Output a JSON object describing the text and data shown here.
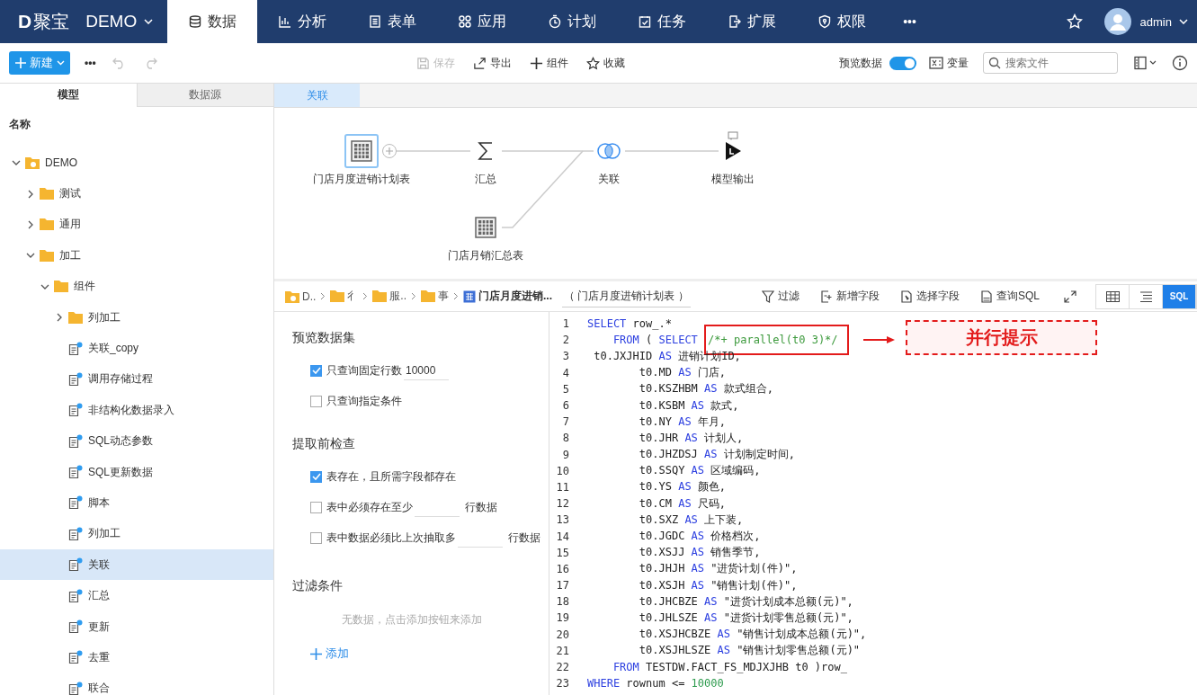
{
  "nav": {
    "logo_letter": "D",
    "logo_text": "聚宝",
    "project": "DEMO",
    "tabs": [
      {
        "label": "数据",
        "selected": true
      },
      {
        "label": "分析",
        "selected": false
      },
      {
        "label": "表单",
        "selected": false
      },
      {
        "label": "应用",
        "selected": false
      },
      {
        "label": "计划",
        "selected": false
      },
      {
        "label": "任务",
        "selected": false
      },
      {
        "label": "扩展",
        "selected": false
      },
      {
        "label": "权限",
        "selected": false
      }
    ],
    "more": "•••",
    "user": "admin"
  },
  "toolbar": {
    "new_button": "新建",
    "more": "•••",
    "actions": [
      {
        "label": "保存",
        "disabled": true
      },
      {
        "label": "导出",
        "disabled": false
      },
      {
        "label": "组件",
        "disabled": false
      },
      {
        "label": "收藏",
        "disabled": false
      }
    ],
    "preview_toggle": {
      "label": "预览数据",
      "on": true
    },
    "variables": "变量",
    "search": {
      "placeholder": "搜索文件"
    }
  },
  "sidebar": {
    "tabs": [
      {
        "label": "模型",
        "selected": true
      },
      {
        "label": "数据源",
        "selected": false
      }
    ],
    "header": "名称",
    "tree": [
      {
        "label": "DEMO",
        "kind": "root",
        "expanded": true,
        "selected": false,
        "children": [
          {
            "label": "测试",
            "kind": "folder",
            "expanded": false,
            "selected": false
          },
          {
            "label": "通用",
            "kind": "folder",
            "expanded": false,
            "selected": false
          },
          {
            "label": "加工",
            "kind": "folder",
            "expanded": true,
            "selected": false,
            "children": [
              {
                "label": "组件",
                "kind": "folder",
                "expanded": true,
                "selected": false,
                "children": [
                  {
                    "label": "列加工",
                    "kind": "folder",
                    "expanded": false,
                    "selected": false
                  },
                  {
                    "label": "关联_copy",
                    "kind": "model",
                    "selected": false
                  },
                  {
                    "label": "调用存储过程",
                    "kind": "model",
                    "selected": false
                  },
                  {
                    "label": "非结构化数据录入",
                    "kind": "model",
                    "selected": false
                  },
                  {
                    "label": "SQL动态参数",
                    "kind": "model",
                    "selected": false
                  },
                  {
                    "label": "SQL更新数据",
                    "kind": "model",
                    "selected": false
                  },
                  {
                    "label": "脚本",
                    "kind": "model",
                    "selected": false
                  },
                  {
                    "label": "列加工",
                    "kind": "model",
                    "selected": false
                  },
                  {
                    "label": "关联",
                    "kind": "model",
                    "selected": true
                  },
                  {
                    "label": "汇总",
                    "kind": "model",
                    "selected": false
                  },
                  {
                    "label": "更新",
                    "kind": "model",
                    "selected": false
                  },
                  {
                    "label": "去重",
                    "kind": "model",
                    "selected": false
                  },
                  {
                    "label": "联合",
                    "kind": "model",
                    "selected": false
                  }
                ]
              }
            ]
          }
        ]
      }
    ]
  },
  "editor_tabs": [
    {
      "label": "关联",
      "selected": true
    }
  ],
  "flow": {
    "nodes": [
      {
        "label": "门店月度进销计划表",
        "kind": "table",
        "selected": true
      },
      {
        "label": "汇总",
        "kind": "sum",
        "selected": false
      },
      {
        "label": "关联",
        "kind": "join",
        "selected": false
      },
      {
        "label": "模型输出",
        "kind": "output",
        "selected": false
      },
      {
        "label": "门店月销汇总表",
        "kind": "table",
        "selected": false
      }
    ]
  },
  "detail": {
    "breadcrumb": [
      {
        "label": "D..",
        "kind": "root"
      },
      {
        "label": "彳",
        "kind": "folder"
      },
      {
        "label": "服..",
        "kind": "folder"
      },
      {
        "label": "事",
        "kind": "folder"
      },
      {
        "label": "门店月度进销...",
        "kind": "table"
      }
    ],
    "alias": "（ 门店月度进销计划表 ）",
    "actions": [
      "过滤",
      "新增字段",
      "选择字段",
      "查询SQL"
    ],
    "views": [
      {
        "kind": "grid",
        "selected": false
      },
      {
        "kind": "list",
        "selected": false
      },
      {
        "kind": "sql",
        "label": "SQL",
        "selected": true
      }
    ]
  },
  "settings": {
    "sections": [
      {
        "title": "预览数据集",
        "options": [
          {
            "label": "只查询固定行数",
            "checked": true,
            "kind": "input",
            "value": "10000"
          },
          {
            "label": "只查询指定条件",
            "checked": false,
            "kind": "plain"
          }
        ]
      },
      {
        "title": "提取前检查",
        "options": [
          {
            "label": "表存在，且所需字段都存在",
            "checked": true,
            "kind": "plain"
          },
          {
            "label": "表中必须存在至少",
            "checked": false,
            "kind": "input",
            "suffix": "行数据"
          },
          {
            "label": "表中数据必须比上次抽取多",
            "checked": false,
            "kind": "input",
            "suffix": "行数据"
          }
        ]
      }
    ],
    "filter": {
      "title": "过滤条件",
      "empty": "无数据，点击添加按钮来添加",
      "add": "添加"
    }
  },
  "sql": {
    "annotation": "并行提示",
    "lines": [
      {
        "number": "1",
        "segments": [
          {
            "text": "SELECT",
            "kind": "kw"
          },
          {
            "text": " row_.*",
            "kind": "plain"
          }
        ]
      },
      {
        "number": "2",
        "segments": [
          {
            "text": "    FROM",
            "kind": "kw"
          },
          {
            "text": " ( ",
            "kind": "plain"
          },
          {
            "text": "SELECT ",
            "kind": "kw"
          },
          {
            "text": "/*+ parallel(t0 3)*/",
            "kind": "comment",
            "marked": true
          }
        ]
      },
      {
        "number": "3",
        "segments": [
          {
            "text": " t0.JXJHID ",
            "kind": "plain"
          },
          {
            "text": "AS",
            "kind": "kw"
          },
          {
            "text": " 进销计划ID,",
            "kind": "plain"
          }
        ]
      },
      {
        "number": "4",
        "segments": [
          {
            "text": "        t0.MD ",
            "kind": "plain"
          },
          {
            "text": "AS",
            "kind": "kw"
          },
          {
            "text": " 门店,",
            "kind": "plain"
          }
        ]
      },
      {
        "number": "5",
        "segments": [
          {
            "text": "        t0.KSZHBM ",
            "kind": "plain"
          },
          {
            "text": "AS",
            "kind": "kw"
          },
          {
            "text": " 款式组合,",
            "kind": "plain"
          }
        ]
      },
      {
        "number": "6",
        "segments": [
          {
            "text": "        t0.KSBM ",
            "kind": "plain"
          },
          {
            "text": "AS",
            "kind": "kw"
          },
          {
            "text": " 款式,",
            "kind": "plain"
          }
        ]
      },
      {
        "number": "7",
        "segments": [
          {
            "text": "        t0.NY ",
            "kind": "plain"
          },
          {
            "text": "AS",
            "kind": "kw"
          },
          {
            "text": " 年月,",
            "kind": "plain"
          }
        ]
      },
      {
        "number": "8",
        "segments": [
          {
            "text": "        t0.JHR ",
            "kind": "plain"
          },
          {
            "text": "AS",
            "kind": "kw"
          },
          {
            "text": " 计划人,",
            "kind": "plain"
          }
        ]
      },
      {
        "number": "9",
        "segments": [
          {
            "text": "        t0.JHZDSJ ",
            "kind": "plain"
          },
          {
            "text": "AS",
            "kind": "kw"
          },
          {
            "text": " 计划制定时间,",
            "kind": "plain"
          }
        ]
      },
      {
        "number": "10",
        "segments": [
          {
            "text": "        t0.SSQY ",
            "kind": "plain"
          },
          {
            "text": "AS",
            "kind": "kw"
          },
          {
            "text": " 区域编码,",
            "kind": "plain"
          }
        ]
      },
      {
        "number": "11",
        "segments": [
          {
            "text": "        t0.YS ",
            "kind": "plain"
          },
          {
            "text": "AS",
            "kind": "kw"
          },
          {
            "text": " 颜色,",
            "kind": "plain"
          }
        ]
      },
      {
        "number": "12",
        "segments": [
          {
            "text": "        t0.CM ",
            "kind": "plain"
          },
          {
            "text": "AS",
            "kind": "kw"
          },
          {
            "text": " 尺码,",
            "kind": "plain"
          }
        ]
      },
      {
        "number": "13",
        "segments": [
          {
            "text": "        t0.SXZ ",
            "kind": "plain"
          },
          {
            "text": "AS",
            "kind": "kw"
          },
          {
            "text": " 上下装,",
            "kind": "plain"
          }
        ]
      },
      {
        "number": "14",
        "segments": [
          {
            "text": "        t0.JGDC ",
            "kind": "plain"
          },
          {
            "text": "AS",
            "kind": "kw"
          },
          {
            "text": " 价格档次,",
            "kind": "plain"
          }
        ]
      },
      {
        "number": "15",
        "segments": [
          {
            "text": "        t0.XSJJ ",
            "kind": "plain"
          },
          {
            "text": "AS",
            "kind": "kw"
          },
          {
            "text": " 销售季节,",
            "kind": "plain"
          }
        ]
      },
      {
        "number": "16",
        "segments": [
          {
            "text": "        t0.JHJH ",
            "kind": "plain"
          },
          {
            "text": "AS",
            "kind": "kw"
          },
          {
            "text": " \"进货计划(件)\",",
            "kind": "plain"
          }
        ]
      },
      {
        "number": "17",
        "segments": [
          {
            "text": "        t0.XSJH ",
            "kind": "plain"
          },
          {
            "text": "AS",
            "kind": "kw"
          },
          {
            "text": " \"销售计划(件)\",",
            "kind": "plain"
          }
        ]
      },
      {
        "number": "18",
        "segments": [
          {
            "text": "        t0.JHCBZE ",
            "kind": "plain"
          },
          {
            "text": "AS",
            "kind": "kw"
          },
          {
            "text": " \"进货计划成本总额(元)\",",
            "kind": "plain"
          }
        ]
      },
      {
        "number": "19",
        "segments": [
          {
            "text": "        t0.JHLSZE ",
            "kind": "plain"
          },
          {
            "text": "AS",
            "kind": "kw"
          },
          {
            "text": " \"进货计划零售总额(元)\",",
            "kind": "plain"
          }
        ]
      },
      {
        "number": "20",
        "segments": [
          {
            "text": "        t0.XSJHCBZE ",
            "kind": "plain"
          },
          {
            "text": "AS",
            "kind": "kw"
          },
          {
            "text": " \"销售计划成本总额(元)\",",
            "kind": "plain"
          }
        ]
      },
      {
        "number": "21",
        "segments": [
          {
            "text": "        t0.XSJHLSZE ",
            "kind": "plain"
          },
          {
            "text": "AS",
            "kind": "kw"
          },
          {
            "text": " \"销售计划零售总额(元)\"",
            "kind": "plain"
          }
        ]
      },
      {
        "number": "22",
        "segments": [
          {
            "text": "    FROM",
            "kind": "kw"
          },
          {
            "text": " TESTDW.FACT_FS_MDJXJHB t0 )row_",
            "kind": "plain"
          }
        ]
      },
      {
        "number": "23",
        "segments": [
          {
            "text": "WHERE",
            "kind": "kw"
          },
          {
            "text": " rownum <= ",
            "kind": "plain"
          },
          {
            "text": "10000",
            "kind": "num"
          }
        ]
      }
    ]
  }
}
